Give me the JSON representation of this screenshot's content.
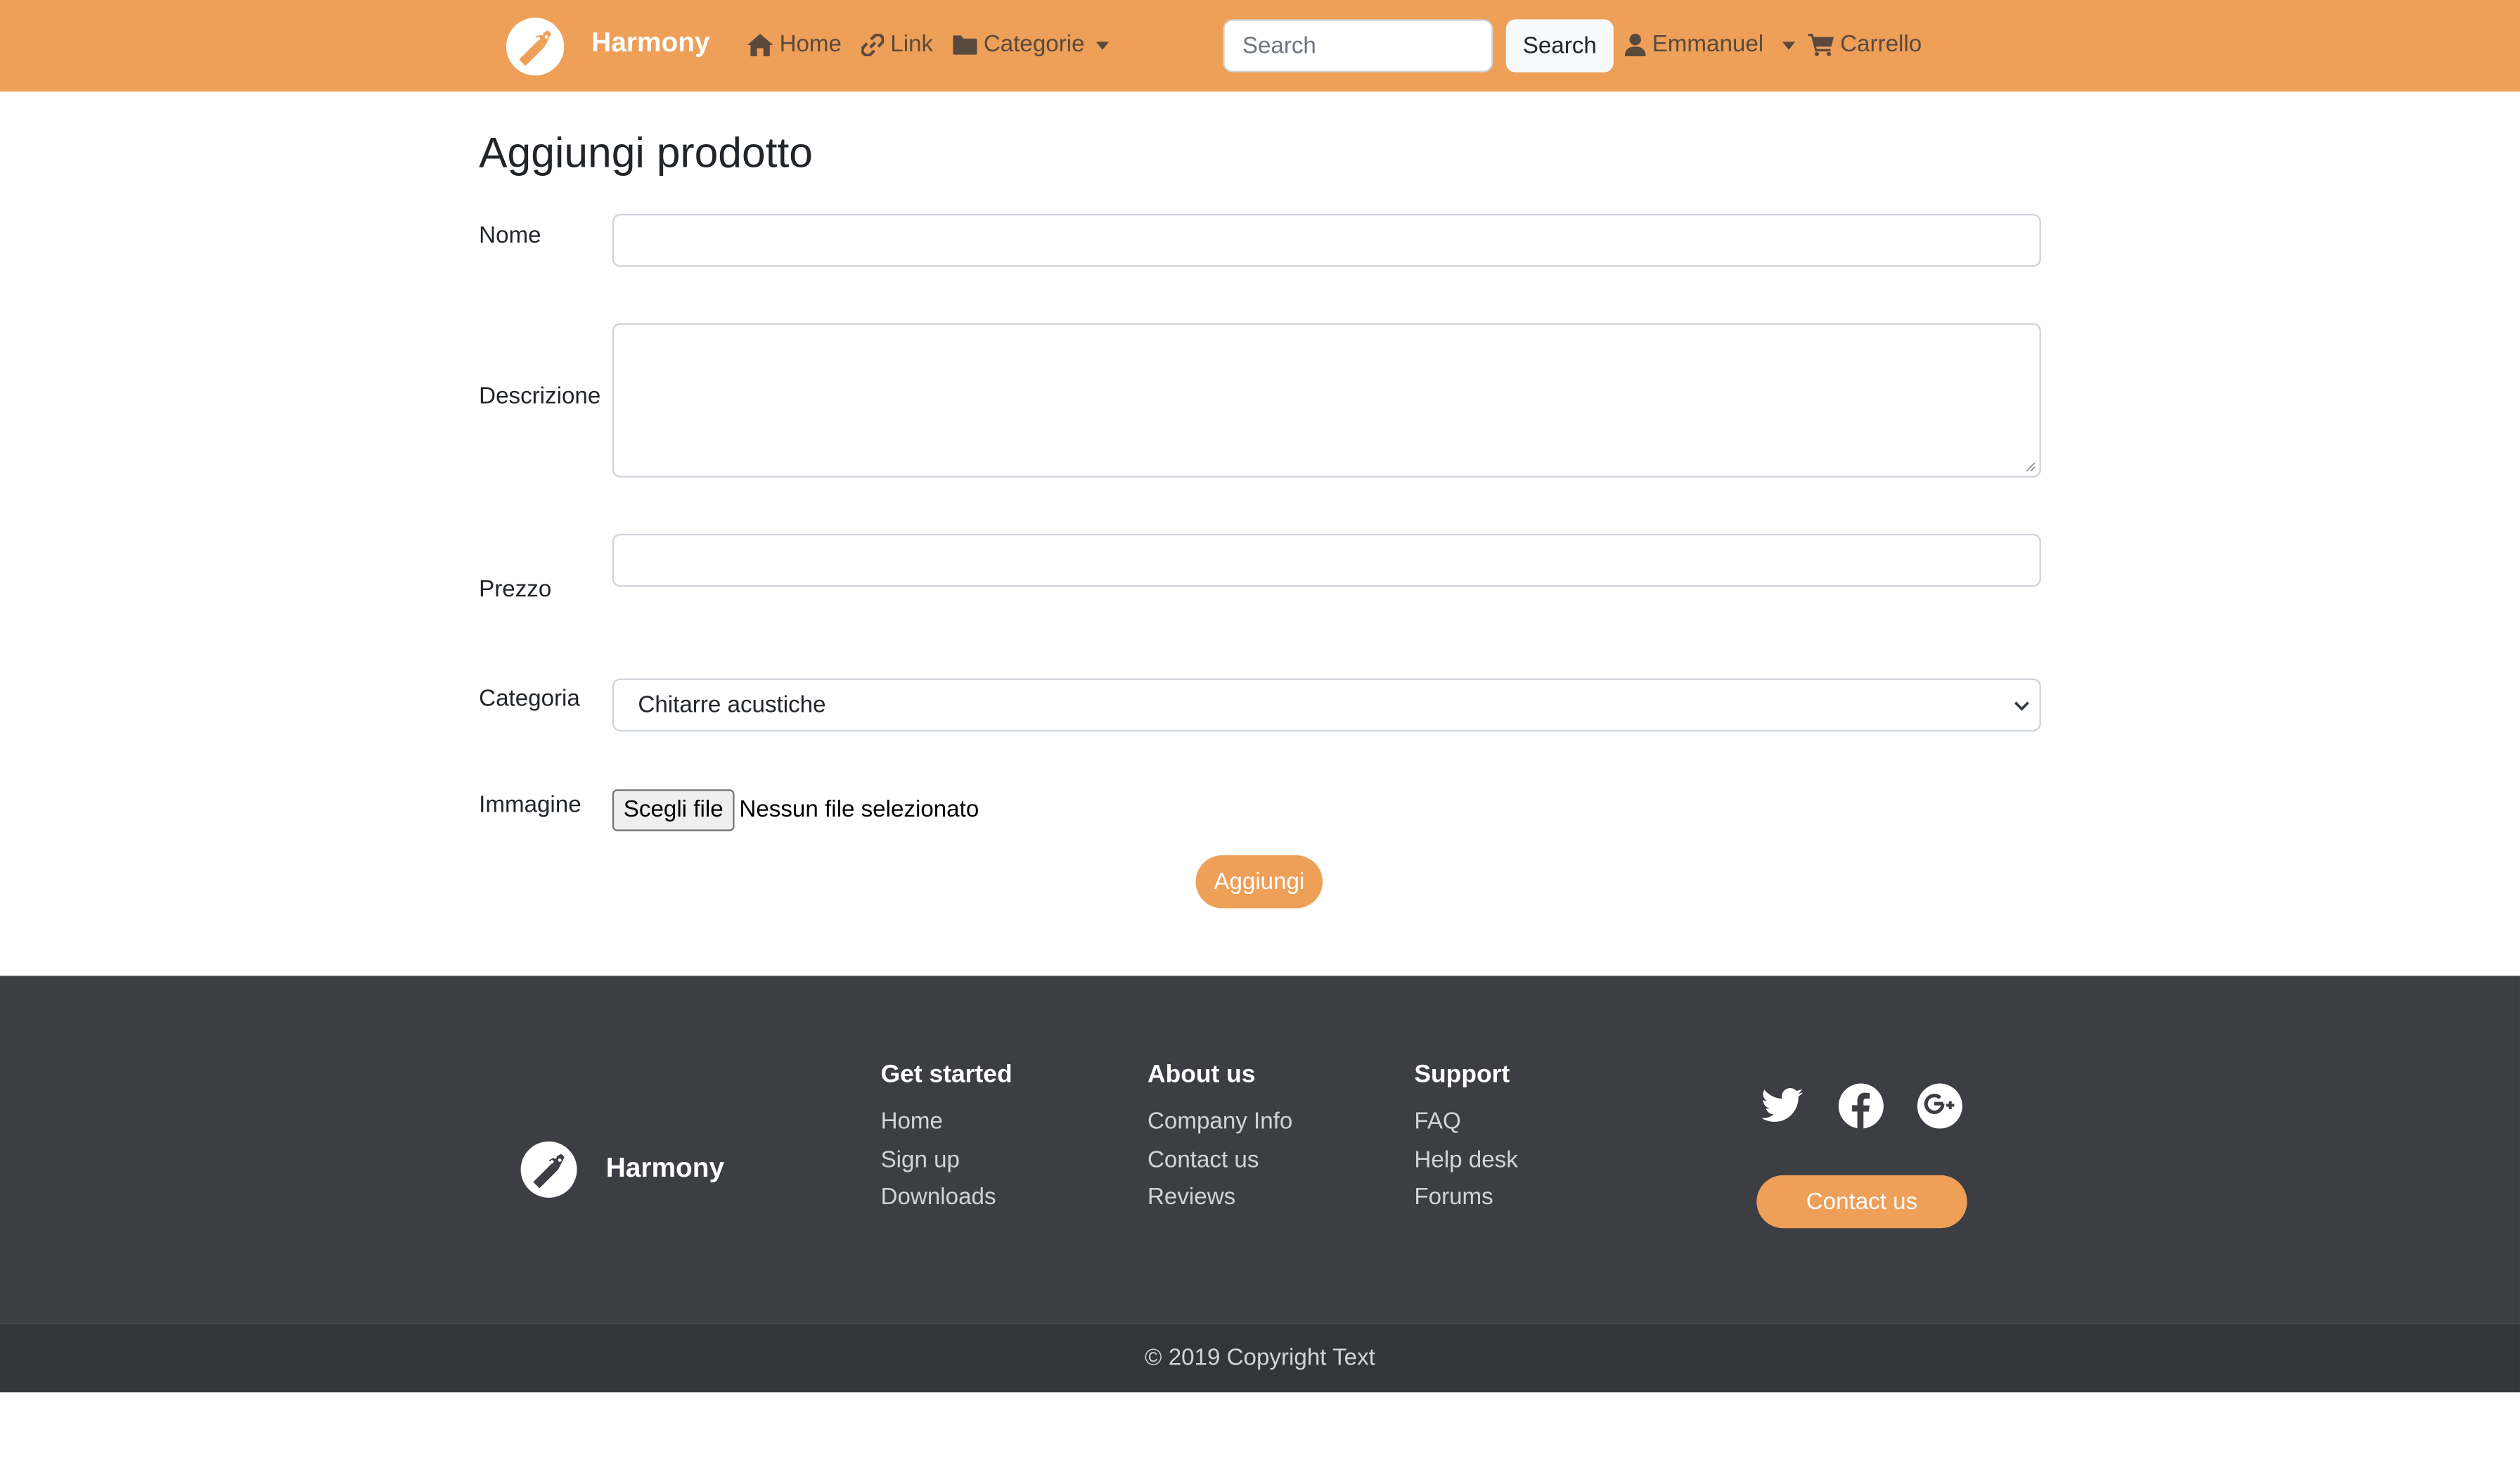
{
  "colors": {
    "accent": "#ee9f58",
    "footer_bg": "#3c3e43",
    "copyright_bg": "#343538"
  },
  "navbar": {
    "brand": "Harmony",
    "brand_icon": "guitar-logo-icon",
    "items": [
      {
        "label": "Home",
        "icon": "house-icon"
      },
      {
        "label": "Link",
        "icon": "link-icon"
      },
      {
        "label": "Categorie",
        "icon": "folder-icon"
      }
    ],
    "search": {
      "placeholder": "Search",
      "value": "",
      "button_label": "Search"
    },
    "user": {
      "label": "Emmanuel",
      "icon": "user-icon"
    },
    "cart": {
      "label": "Carrello",
      "icon": "cart-icon"
    }
  },
  "form": {
    "title": "Aggiungi prodotto",
    "fields": {
      "nome": {
        "label": "Nome",
        "value": ""
      },
      "descrizione": {
        "label": "Descrizione",
        "value": ""
      },
      "prezzo": {
        "label": "Prezzo",
        "value": ""
      },
      "categoria": {
        "label": "Categoria",
        "selected": "Chitarre acustiche"
      },
      "immagine": {
        "label": "Immagine",
        "button_label": "Scegli file",
        "status": "Nessun file selezionato"
      }
    },
    "submit_label": "Aggiungi"
  },
  "footer": {
    "brand": "Harmony",
    "columns": [
      {
        "title": "Get started",
        "links": [
          "Home",
          "Sign up",
          "Downloads"
        ]
      },
      {
        "title": "About us",
        "links": [
          "Company Info",
          "Contact us",
          "Reviews"
        ]
      },
      {
        "title": "Support",
        "links": [
          "FAQ",
          "Help desk",
          "Forums"
        ]
      }
    ],
    "social_icons": [
      "twitter-icon",
      "facebook-icon",
      "google-plus-icon"
    ],
    "contact_label": "Contact us",
    "copyright": "© 2019 Copyright Text"
  }
}
